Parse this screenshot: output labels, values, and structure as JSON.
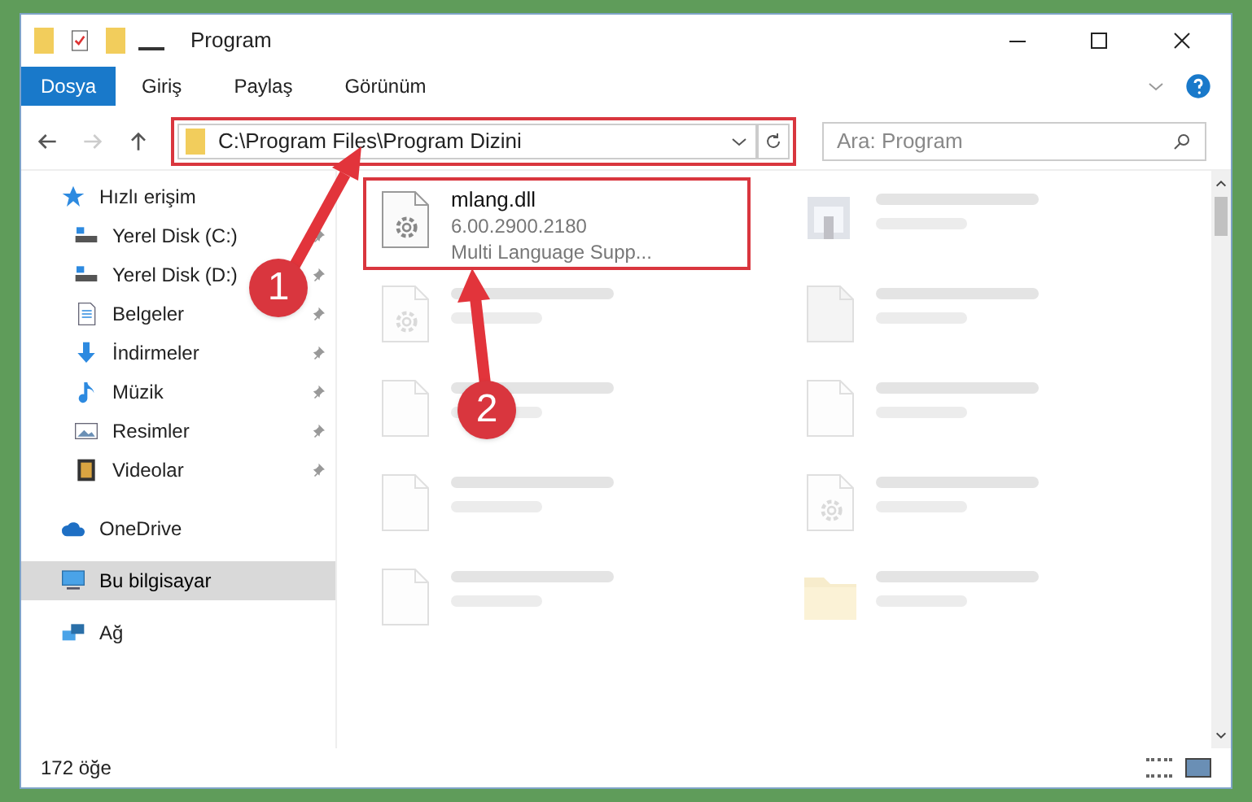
{
  "window": {
    "title": "Program"
  },
  "ribbon_tabs": [
    {
      "label": "Dosya",
      "selected": true
    },
    {
      "label": "Giriş",
      "selected": false
    },
    {
      "label": "Paylaş",
      "selected": false
    },
    {
      "label": "Görünüm",
      "selected": false
    }
  ],
  "address": {
    "path": "C:\\Program Files\\Program Dizini",
    "highlighted": true
  },
  "search": {
    "placeholder": "Ara: Program"
  },
  "sidebar": {
    "items": [
      {
        "label": "Hızlı erişim",
        "kind": "star",
        "selected": false,
        "children": [
          {
            "label": "Yerel Disk (C:)",
            "kind": "drive",
            "pinned": true,
            "selected": false
          },
          {
            "label": "Yerel Disk (D:)",
            "kind": "drive",
            "pinned": true,
            "selected": false
          },
          {
            "label": "Belgeler",
            "kind": "document",
            "pinned": true,
            "selected": false
          },
          {
            "label": "İndirmeler",
            "kind": "download",
            "pinned": true,
            "selected": false
          },
          {
            "label": "Müzik",
            "kind": "music",
            "pinned": true,
            "selected": false
          },
          {
            "label": "Resimler",
            "kind": "picture",
            "pinned": true,
            "selected": false
          },
          {
            "label": "Videolar",
            "kind": "video",
            "pinned": true,
            "selected": false
          }
        ]
      },
      {
        "label": "OneDrive",
        "kind": "cloud",
        "selected": false
      },
      {
        "label": "Bu bilgisayar",
        "kind": "computer",
        "selected": true
      },
      {
        "label": "Ağ",
        "kind": "network",
        "selected": false
      }
    ]
  },
  "files": [
    {
      "name": "mlang.dll",
      "lines": [
        "6.00.2900.2180",
        "Multi Language Supp..."
      ],
      "kind": "dll",
      "highlighted": true,
      "blurred": false
    },
    {
      "kind": "exe",
      "highlighted": false,
      "blurred": true
    },
    {
      "kind": "dll",
      "highlighted": false,
      "blurred": true
    },
    {
      "kind": "blank",
      "highlighted": false,
      "blurred": true
    },
    {
      "kind": "doc",
      "highlighted": false,
      "blurred": true
    },
    {
      "kind": "doc",
      "highlighted": false,
      "blurred": true
    },
    {
      "kind": "doc",
      "highlighted": false,
      "blurred": true
    },
    {
      "kind": "dll",
      "highlighted": false,
      "blurred": true
    },
    {
      "kind": "doc",
      "highlighted": false,
      "blurred": true
    },
    {
      "kind": "folder",
      "highlighted": false,
      "blurred": true
    }
  ],
  "status_bar": {
    "count": "172 öğe"
  },
  "annotations": [
    {
      "number": "1"
    },
    {
      "number": "2"
    }
  ]
}
